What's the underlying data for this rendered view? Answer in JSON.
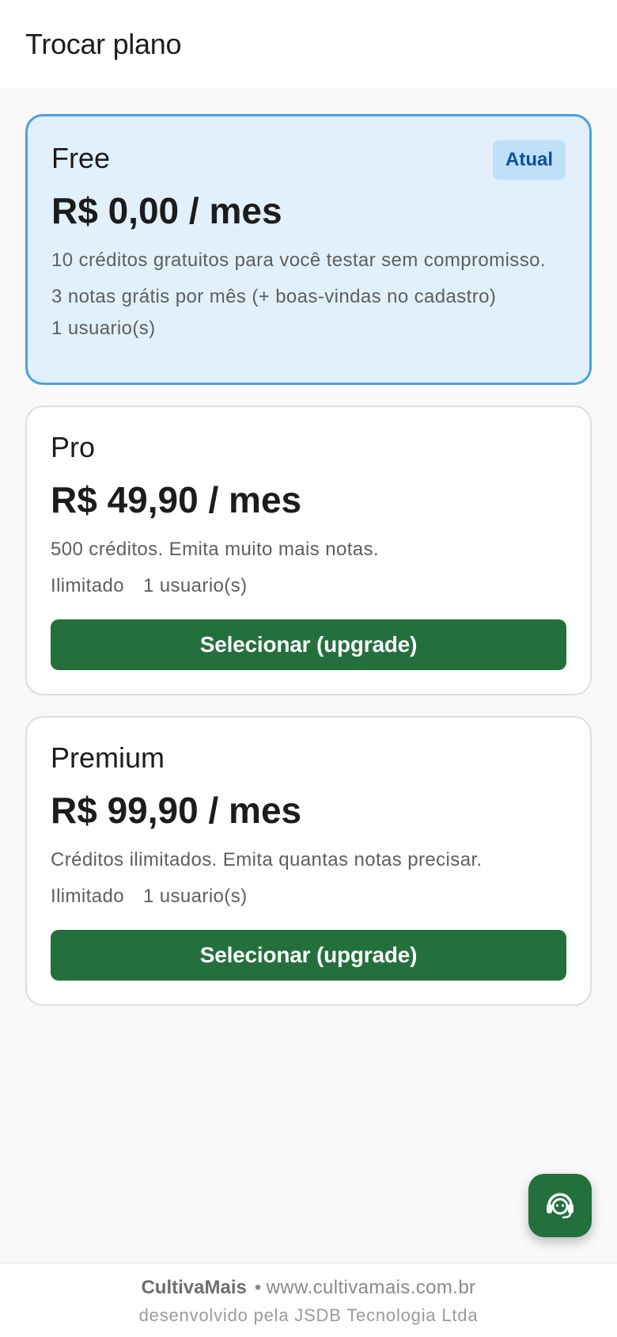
{
  "header": {
    "title": "Trocar plano"
  },
  "plans": [
    {
      "name": "Free",
      "price": "R$ 0,00 / mes",
      "description": "10 créditos gratuitos para você testar sem compromisso.",
      "extra": "3 notas grátis por mês (+ boas-vindas no cadastro)",
      "users": "1 usuario(s)",
      "badge": "Atual",
      "current": true
    },
    {
      "name": "Pro",
      "price": "R$ 49,90 / mes",
      "description": "500 créditos. Emita muito mais notas.",
      "limit": "Ilimitado",
      "users": "1 usuario(s)",
      "button_label": "Selecionar (upgrade)"
    },
    {
      "name": "Premium",
      "price": "R$ 99,90 / mes",
      "description": "Créditos ilimitados. Emita quantas notas precisar.",
      "limit": "Ilimitado",
      "users": "1 usuario(s)",
      "button_label": "Selecionar (upgrade)"
    }
  ],
  "fab": {
    "icon": "support-agent-icon"
  },
  "footer": {
    "brand": "CultivaMais",
    "separator": "•",
    "website": "www.cultivamais.com.br",
    "developer": "desenvolvido pela JSDB Tecnologia Ltda"
  },
  "colors": {
    "primary_green": "#23703c",
    "current_bg": "#e2f0fb",
    "current_border": "#46a2e4",
    "badge_bg": "#bfe0f8",
    "badge_text": "#0d4ea0",
    "page_bg": "#f9f9f9"
  }
}
